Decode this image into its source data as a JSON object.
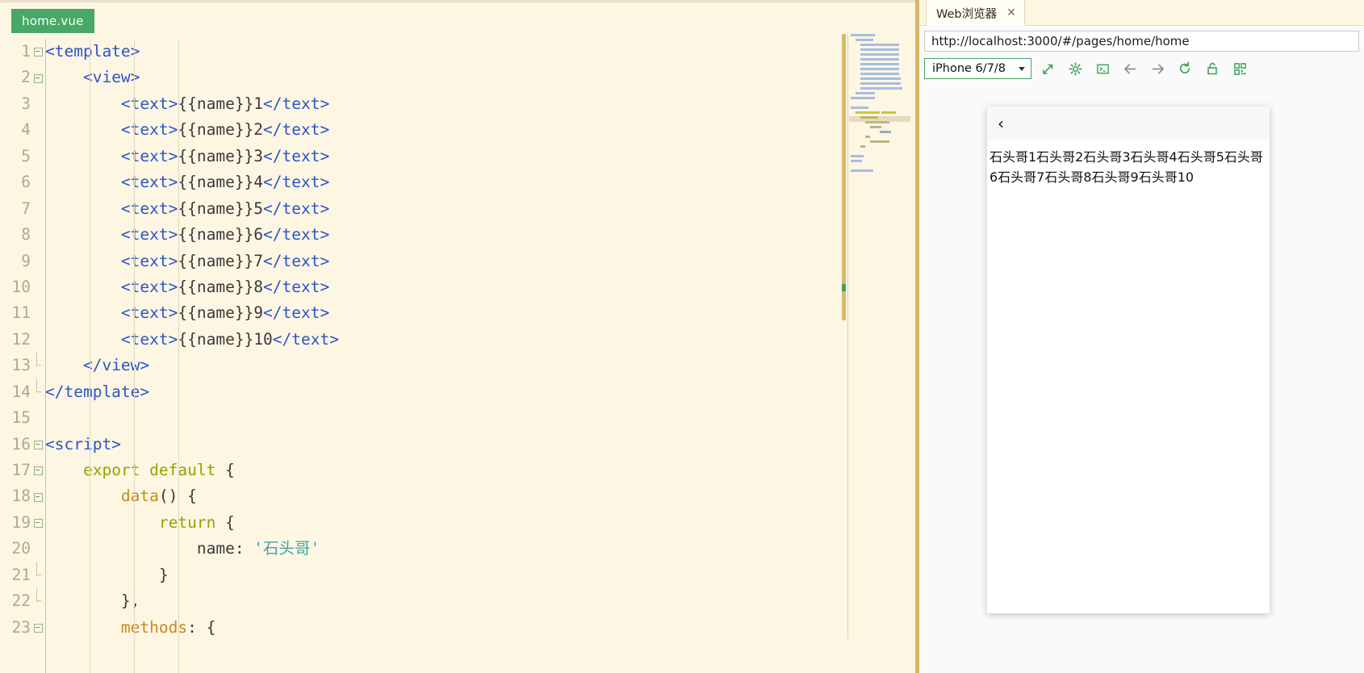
{
  "editor": {
    "file_tab_label": "home.vue",
    "tab_color": "#47a867",
    "background": "#fdf6e3",
    "lines": [
      {
        "num": "1",
        "fold": "box",
        "indent": 0,
        "text": "<template>"
      },
      {
        "num": "2",
        "fold": "box",
        "indent": 0,
        "text": "    <view>"
      },
      {
        "num": "3",
        "fold": "none",
        "indent": 1,
        "text": "        <text>{{name}}1</text>"
      },
      {
        "num": "4",
        "fold": "none",
        "indent": 1,
        "text": "        <text>{{name}}2</text>"
      },
      {
        "num": "5",
        "fold": "none",
        "indent": 1,
        "text": "        <text>{{name}}3</text>"
      },
      {
        "num": "6",
        "fold": "none",
        "indent": 1,
        "text": "        <text>{{name}}4</text>"
      },
      {
        "num": "7",
        "fold": "none",
        "indent": 1,
        "text": "        <text>{{name}}5</text>"
      },
      {
        "num": "8",
        "fold": "none",
        "indent": 1,
        "text": "        <text>{{name}}6</text>"
      },
      {
        "num": "9",
        "fold": "none",
        "indent": 1,
        "text": "        <text>{{name}}7</text>"
      },
      {
        "num": "10",
        "fold": "none",
        "indent": 1,
        "text": "        <text>{{name}}8</text>"
      },
      {
        "num": "11",
        "fold": "none",
        "indent": 1,
        "text": "        <text>{{name}}9</text>"
      },
      {
        "num": "12",
        "fold": "none",
        "indent": 1,
        "text": "        <text>{{name}}10</text>"
      },
      {
        "num": "13",
        "fold": "tickend",
        "indent": 0,
        "text": "    </view>"
      },
      {
        "num": "14",
        "fold": "tickend",
        "indent": 0,
        "text": "</template>"
      },
      {
        "num": "15",
        "fold": "none",
        "indent": 0,
        "text": ""
      },
      {
        "num": "16",
        "fold": "box",
        "indent": 0,
        "text": "<script>"
      },
      {
        "num": "17",
        "fold": "box",
        "indent": 0,
        "text": "    export default {"
      },
      {
        "num": "18",
        "fold": "box",
        "indent": 1,
        "text": "        data() {"
      },
      {
        "num": "19",
        "fold": "box",
        "indent": 2,
        "text": "            return {"
      },
      {
        "num": "20",
        "fold": "none",
        "indent": 3,
        "text": "                name: '石头哥'"
      },
      {
        "num": "21",
        "fold": "tickend",
        "indent": 2,
        "text": "            }"
      },
      {
        "num": "22",
        "fold": "tickend",
        "indent": 1,
        "text": "        },"
      },
      {
        "num": "23",
        "fold": "box",
        "indent": 1,
        "text": "        methods: {"
      }
    ]
  },
  "browser": {
    "tab_label": "Web浏览器",
    "tab_close_glyph": "✕",
    "url": "http://localhost:3000/#/pages/home/home",
    "device": "iPhone 6/7/8",
    "toolbar_icons": [
      "open-external-icon",
      "settings-gear-icon",
      "console-icon",
      "back-arrow-icon",
      "forward-arrow-icon",
      "refresh-icon",
      "unlock-icon",
      "qrcode-icon"
    ],
    "accent_color": "#3fa35a"
  },
  "phone": {
    "back_glyph": "‹",
    "content": "石头哥1石头哥2石头哥3石头哥4石头哥5石头哥6石头哥7石头哥8石头哥9石头哥10"
  }
}
